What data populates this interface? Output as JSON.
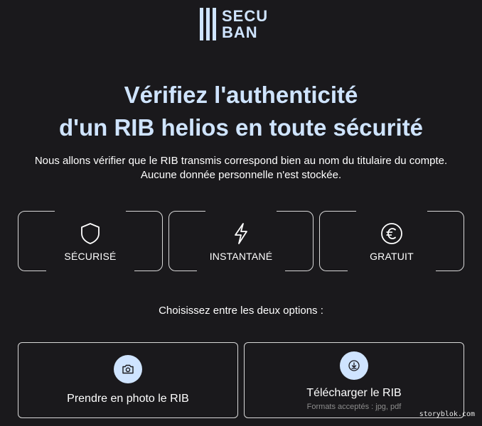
{
  "logo": {
    "line1": "SECU",
    "line2": "BAN"
  },
  "headline": {
    "line1": "Vérifiez l'authenticité",
    "line2": "d'un RIB helios en toute sécurité"
  },
  "subtitle": {
    "line1": "Nous allons vérifier que le RIB transmis correspond bien au nom du titulaire du compte.",
    "line2": "Aucune donnée personnelle n'est stockée."
  },
  "features": [
    {
      "label": "SÉCURISÉ",
      "icon": "shield-icon"
    },
    {
      "label": "INSTANTANÉ",
      "icon": "lightning-icon"
    },
    {
      "label": "GRATUIT",
      "icon": "euro-icon"
    }
  ],
  "choose_text": "Choisissez entre les deux options :",
  "options": [
    {
      "title": "Prendre en photo le RIB",
      "icon": "camera-icon"
    },
    {
      "title": "Télécharger le RIB",
      "hint": "Formats acceptés : jpg, pdf",
      "icon": "download-icon"
    }
  ],
  "watermark": "storyblok.com",
  "colors": {
    "background": "#1a191c",
    "accent": "#cfe4ff",
    "border": "#d8d8d8",
    "muted": "#8c8c8c"
  }
}
